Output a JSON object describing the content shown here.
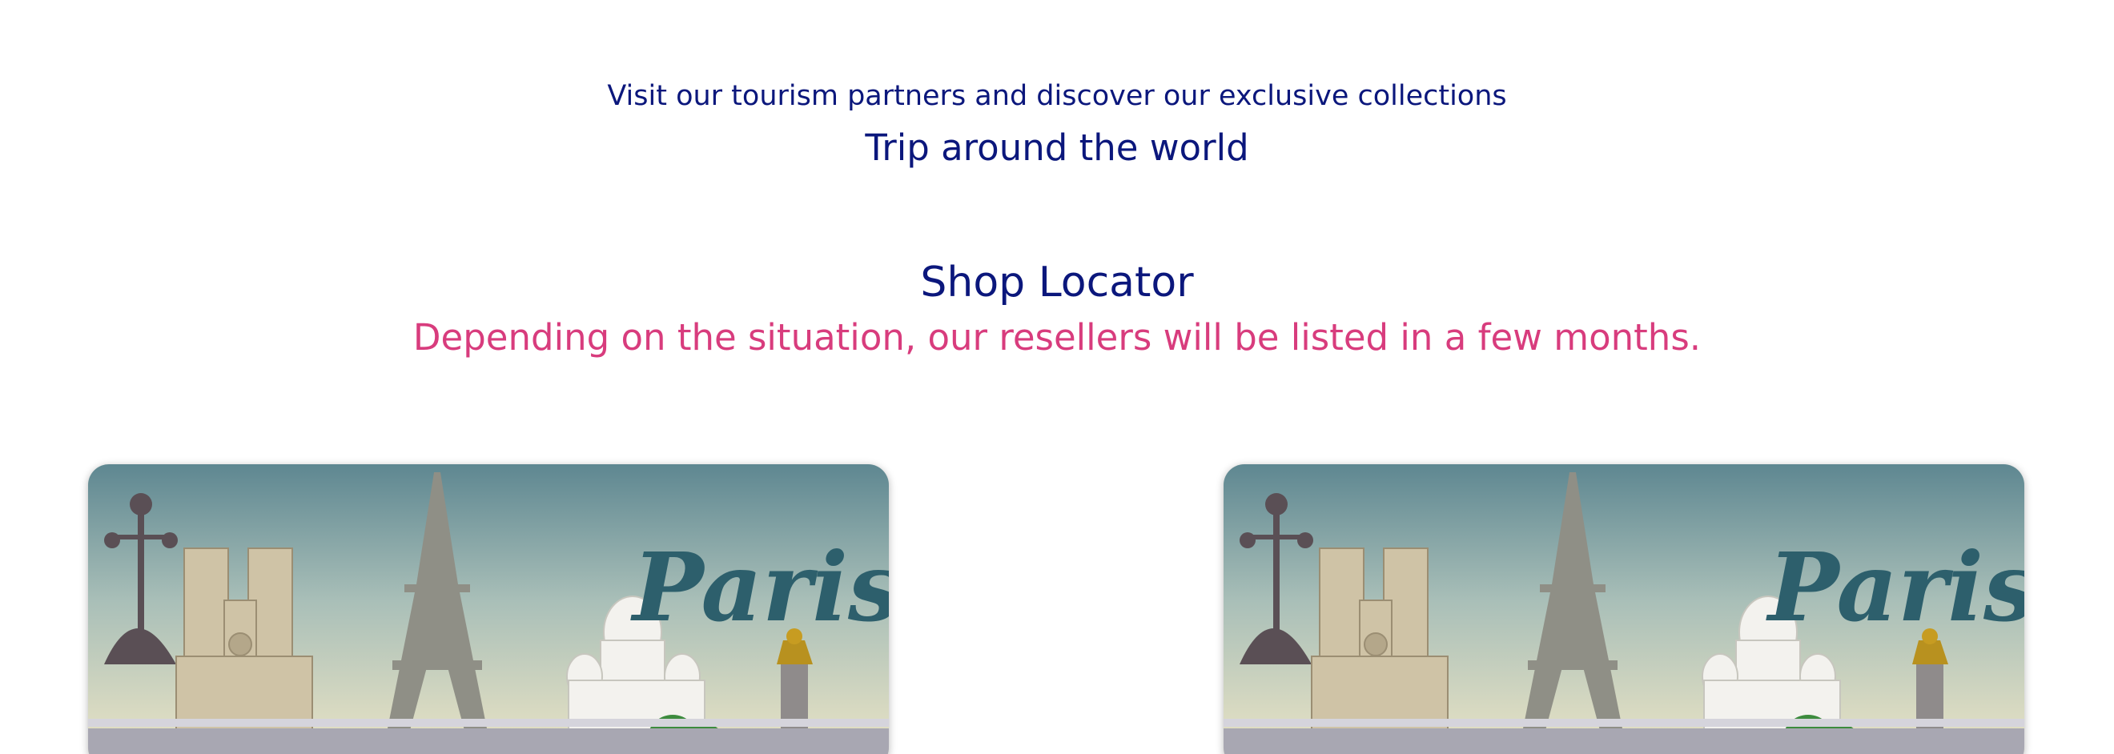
{
  "intro": {
    "subtitle": "Visit our tourism partners and discover our exclusive collections",
    "title": "Trip around the world"
  },
  "shop_locator": {
    "title": "Shop Locator",
    "note": "Depending on the situation, our resellers will be listed in a few months."
  },
  "cards": [
    {
      "image_text": "Paris"
    },
    {
      "image_text": "Paris"
    }
  ],
  "colors": {
    "heading": "#0b177c",
    "accent": "#d83c7d",
    "paris_script": "#2d5f6c"
  }
}
